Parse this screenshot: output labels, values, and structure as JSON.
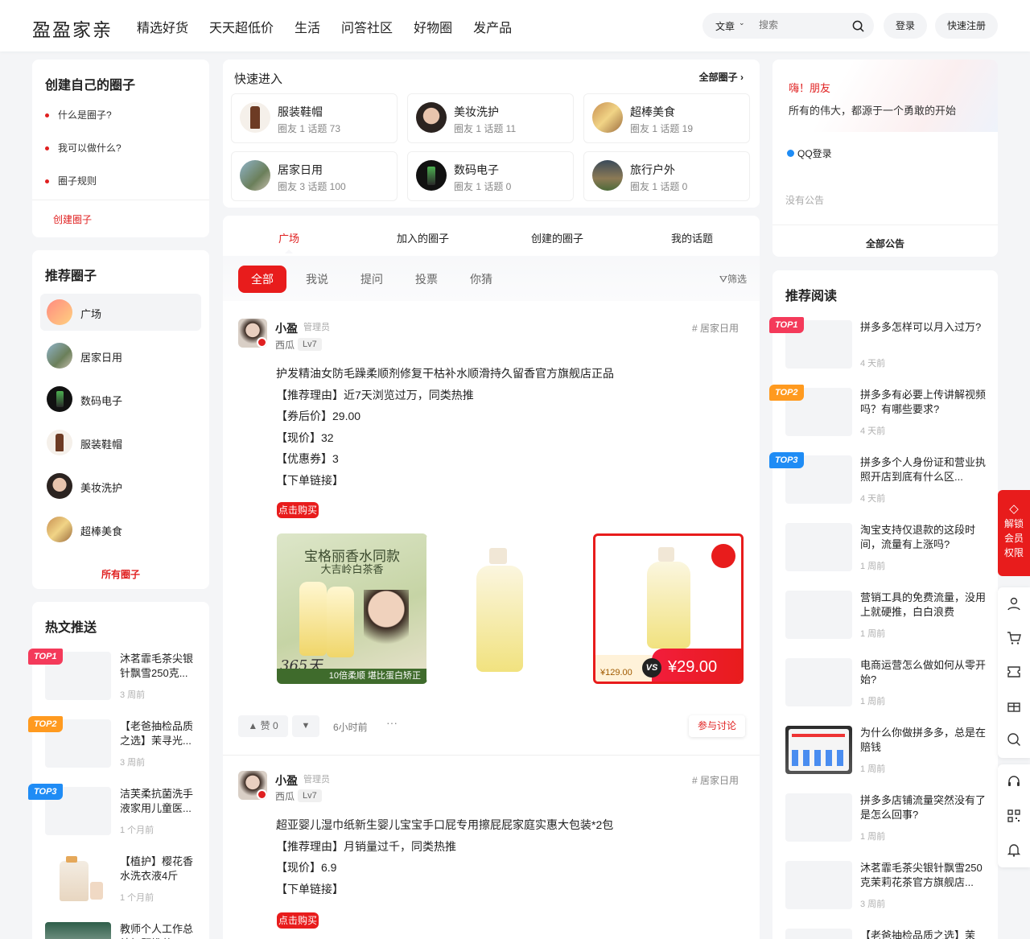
{
  "header": {
    "logo": "盈盈家亲",
    "nav": [
      "精选好货",
      "天天超低价",
      "生活",
      "问答社区",
      "好物圈",
      "发产品"
    ],
    "search_type": "文章",
    "search_placeholder": "搜索",
    "login": "登录",
    "register": "快速注册"
  },
  "create_circle": {
    "title": "创建自己的圈子",
    "items": [
      "什么是圈子?",
      "我可以做什么?",
      "圈子规则"
    ],
    "link": "创建圈子"
  },
  "recommend_circles": {
    "title": "推荐圈子",
    "items": [
      "广场",
      "居家日用",
      "数码电子",
      "服装鞋帽",
      "美妆洗护",
      "超棒美食"
    ],
    "link": "所有圈子"
  },
  "hot_articles": {
    "title": "热文推送",
    "items": [
      {
        "badge": "TOP1",
        "title": "沐茗霏毛茶尖银针飘雪250克...",
        "time": "3 周前"
      },
      {
        "badge": "TOP2",
        "title": "【老爸抽检品质之选】茉寻光...",
        "time": "3 周前"
      },
      {
        "badge": "TOP3",
        "title": "洁芙柔抗菌洗手液家用儿童医...",
        "time": "1 个月前"
      },
      {
        "badge": "",
        "title": "【植护】樱花香水洗衣液4斤",
        "time": "1 个月前"
      },
      {
        "badge": "",
        "title": "教师个人工作总结标题推荐...",
        "time": ""
      }
    ]
  },
  "quick_entry": {
    "title": "快速进入",
    "all_link": "全部圈子",
    "circles": [
      {
        "name": "服装鞋帽",
        "stats": "圈友 1 话题 73"
      },
      {
        "name": "美妆洗护",
        "stats": "圈友 1 话题 11"
      },
      {
        "name": "超棒美食",
        "stats": "圈友 1 话题 19"
      },
      {
        "name": "居家日用",
        "stats": "圈友 3 话题 100"
      },
      {
        "name": "数码电子",
        "stats": "圈友 1 话题 0"
      },
      {
        "name": "旅行户外",
        "stats": "圈友 1 话题 0"
      }
    ]
  },
  "feed": {
    "tabs": [
      "广场",
      "加入的圈子",
      "创建的圈子",
      "我的话题"
    ],
    "filters": [
      "全部",
      "我说",
      "提问",
      "投票",
      "你猜"
    ],
    "filter_btn": "筛选",
    "posts": [
      {
        "author": "小盈",
        "role": "管理员",
        "location": "西瓜",
        "level": "Lv7",
        "tag": "居家日用",
        "lines": [
          "护发精油女防毛躁柔顺剂修复干枯补水顺滑持久留香官方旗舰店正品",
          "【推荐理由】近7天浏览过万，同类热推",
          "【券后价】29.00",
          "【现价】32",
          "【优惠券】3",
          "【下单链接】"
        ],
        "buy": "点击购买",
        "img1_title": "宝格丽香水同款",
        "img1_sub": "大吉岭白茶香",
        "img1_price": "365天",
        "img1_banner": "10倍柔顺 堪比蛋白矫正",
        "img3_old": "¥129.00",
        "img3_new": "¥29.00",
        "img3_vs": "VS",
        "likes": "赞 0",
        "time": "6小时前",
        "discuss": "参与讨论"
      },
      {
        "author": "小盈",
        "role": "管理员",
        "location": "西瓜",
        "level": "Lv7",
        "tag": "居家日用",
        "lines": [
          "超亚婴儿湿巾纸新生婴儿宝宝手口屁专用擦屁屁家庭实惠大包装*2包",
          "【推荐理由】月销量过千，同类热推",
          "【现价】6.9",
          "【下单链接】"
        ],
        "buy": "点击购买"
      }
    ]
  },
  "notice": {
    "hi": "嗨！朋友",
    "slogan": "所有的伟大，都源于一个勇敢的开始",
    "qq_login": "QQ登录",
    "empty": "没有公告",
    "all_link": "全部公告"
  },
  "reading": {
    "title": "推荐阅读",
    "items": [
      {
        "badge": "TOP1",
        "title": "拼多多怎样可以月入过万?",
        "time": "4 天前"
      },
      {
        "badge": "TOP2",
        "title": "拼多多有必要上传讲解视频吗？有哪些要求?",
        "time": "4 天前"
      },
      {
        "badge": "TOP3",
        "title": "拼多多个人身份证和营业执照开店到底有什么区...",
        "time": "4 天前"
      },
      {
        "badge": "",
        "title": "淘宝支持仅退款的这段时间，流量有上涨吗?",
        "time": "1 周前"
      },
      {
        "badge": "",
        "title": "营销工具的免费流量，没用上就硬推，白白浪费",
        "time": "1 周前"
      },
      {
        "badge": "",
        "title": "电商运营怎么做如何从零开始?",
        "time": "1 周前"
      },
      {
        "badge": "",
        "title": "为什么你做拼多多，总是在赔钱",
        "time": "1 周前"
      },
      {
        "badge": "",
        "title": "拼多多店铺流量突然没有了是怎么回事?",
        "time": "1 周前"
      },
      {
        "badge": "",
        "title": "沐茗霏毛茶尖银针飘雪250克茉莉花茶官方旗舰店...",
        "time": "3 周前"
      },
      {
        "badge": "",
        "title": "【老爸抽检品质之选】茉",
        "time": ""
      }
    ]
  },
  "side": {
    "vip": [
      "解锁",
      "会员",
      "权限"
    ]
  },
  "colors": {
    "accent": "#e81c1c",
    "top1": "#f43a5a",
    "top2": "#ff9a1f",
    "top3": "#1f8cf5"
  }
}
